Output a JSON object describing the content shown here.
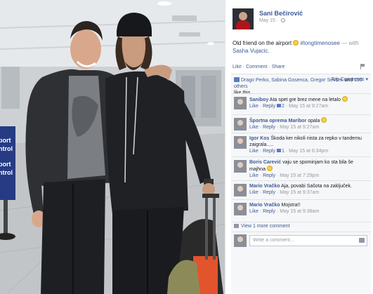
{
  "post": {
    "author": "Sani Bečirović",
    "date": "May 15",
    "caption_text": "Old friend on the airport",
    "hashtag": "#longtimenosee",
    "with_text": "— with",
    "tagged": "Sasha Vujacic."
  },
  "actions": {
    "like": "Like",
    "comment": "Comment",
    "share": "Share",
    "top_comments": "Top Comments ▾"
  },
  "likes": {
    "names": "Drago Perko, Sabina Gosenca, Gregor Sevšek",
    "and": "and",
    "others": "190 others",
    "suffix": "like this."
  },
  "comments": [
    {
      "name": "Saniboy",
      "text": "Ata spet gre brez mene na letalo",
      "smiley": true,
      "likes": "2",
      "time": "May 15 at 9:27am"
    },
    {
      "name": "Športna oprema Maribor",
      "text": "opala",
      "smiley": true,
      "likes": "",
      "time": "May 15 at 9:27am"
    },
    {
      "name": "Igor Kos",
      "text": "Škoda ker nikoli nista za repko v tandemu zaigrala.....",
      "smiley": false,
      "likes": "1",
      "time": "May 15 at 6:34pm"
    },
    {
      "name": "Boris Carević",
      "text": "vaju se spominjam ko sta bila še majhna",
      "smiley": true,
      "likes": "",
      "time": "May 15 at 7:29pm"
    },
    {
      "name": "Mario Vračko",
      "text": "Aja, povabi Sašota na zaključek.",
      "smiley": false,
      "likes": "",
      "time": "May 15 at 9:37am"
    },
    {
      "name": "Mario Vračko",
      "text": "Mojstra!!",
      "smiley": false,
      "likes": "",
      "time": "May 15 at 9:38am"
    }
  ],
  "comment_meta": {
    "like": "Like",
    "reply": "Reply",
    "sep": "·"
  },
  "view_more": "View 1 more comment",
  "write_placeholder": "Write a comment...",
  "photo_sign": {
    "line1": "port",
    "line2": "ntrol",
    "line3": "port",
    "line4": "ntrol"
  },
  "colors": {
    "fb_blue": "#3b5998",
    "muted": "#9197a3",
    "ufi_bg": "#f6f7f8",
    "sign_blue": "#263b83"
  }
}
